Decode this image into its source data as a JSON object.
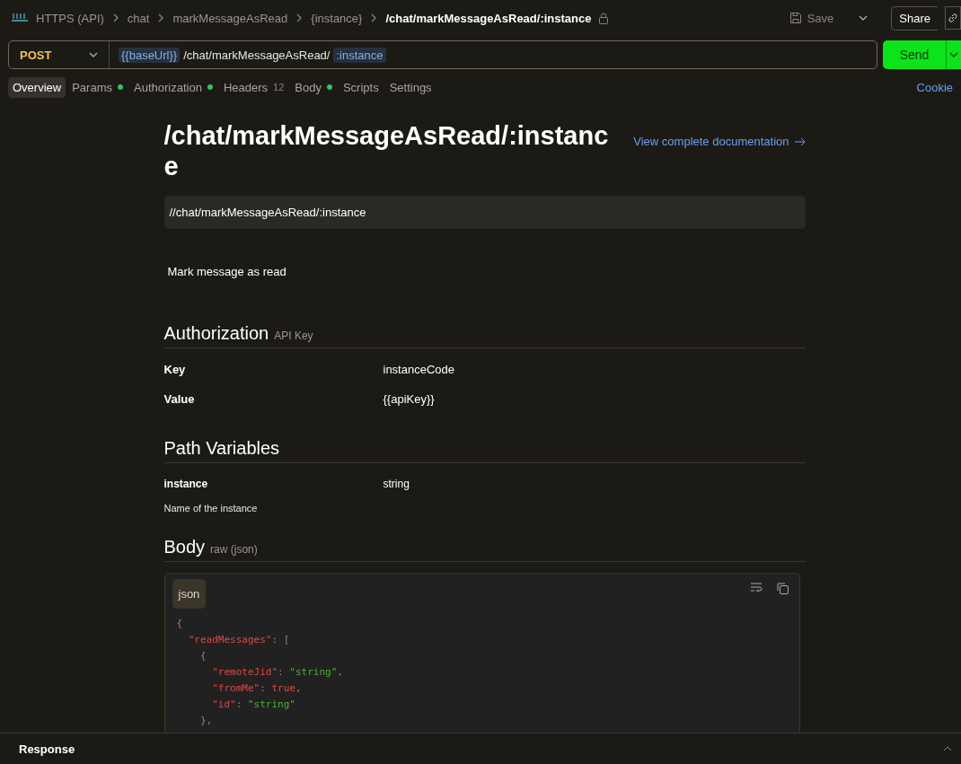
{
  "breadcrumb": {
    "items": [
      {
        "text": "HTTPS (API)"
      },
      {
        "text": "chat"
      },
      {
        "text": "markMessageAsRead"
      },
      {
        "text": "{instance}"
      }
    ],
    "current": "/chat/markMessageAsRead/:instance",
    "locked": true
  },
  "actions": {
    "save": "Save",
    "share": "Share"
  },
  "request": {
    "method": "POST",
    "url": [
      {
        "kind": "variable",
        "text": "{{baseUrl}}"
      },
      {
        "kind": "plain",
        "text": "/chat/markMessageAsRead/"
      },
      {
        "kind": "param",
        "text": ":instance"
      }
    ],
    "send": "Send"
  },
  "tabs": [
    {
      "label": "Overview",
      "selected": true,
      "dot": false
    },
    {
      "label": "Params",
      "selected": false,
      "dot": true
    },
    {
      "label": "Authorization",
      "selected": false,
      "dot": true
    },
    {
      "label": "Headers",
      "count": "12",
      "selected": false,
      "dot": false
    },
    {
      "label": "Body",
      "selected": false,
      "dot": true
    },
    {
      "label": "Scripts",
      "selected": false,
      "dot": false
    },
    {
      "label": "Settings",
      "selected": false,
      "dot": false
    }
  ],
  "cookies": "Cookie",
  "doc": {
    "title": "/chat/markMessageAsRead/:instance",
    "doc_link": "View complete documentation",
    "path": "//chat/markMessageAsRead/:instance",
    "description": "Mark message as read",
    "authorization": {
      "heading": "Authorization",
      "type": "API Key",
      "rows": [
        {
          "name": "Key",
          "value": "instanceCode"
        },
        {
          "name": "Value",
          "value": "{{apiKey}}"
        }
      ]
    },
    "path_variables": {
      "heading": "Path Variables",
      "rows": [
        {
          "name": "instance",
          "type": "string",
          "description": "Name of the instance"
        }
      ]
    },
    "body": {
      "heading": "Body",
      "type": "raw (json)",
      "language": "json",
      "lines": [
        [
          {
            "kind": "punct",
            "text": "{"
          }
        ],
        [
          {
            "kind": "key",
            "text": "  \"readMessages\""
          },
          {
            "kind": "punct",
            "text": ": ["
          }
        ],
        [
          {
            "kind": "punct",
            "text": "    {"
          }
        ],
        [
          {
            "kind": "key",
            "text": "      \"remoteJid\""
          },
          {
            "kind": "punct",
            "text": ": "
          },
          {
            "kind": "string",
            "text": "\"string\""
          },
          {
            "kind": "punct",
            "text": ","
          }
        ],
        [
          {
            "kind": "key",
            "text": "      \"fromMe\""
          },
          {
            "kind": "punct",
            "text": ": "
          },
          {
            "kind": "literal",
            "text": "true"
          },
          {
            "kind": "punct",
            "text": ","
          }
        ],
        [
          {
            "kind": "key",
            "text": "      \"id\""
          },
          {
            "kind": "punct",
            "text": ": "
          },
          {
            "kind": "string",
            "text": "\"string\""
          }
        ],
        [
          {
            "kind": "punct",
            "text": "    },"
          }
        ]
      ]
    }
  },
  "response": {
    "label": "Response"
  }
}
